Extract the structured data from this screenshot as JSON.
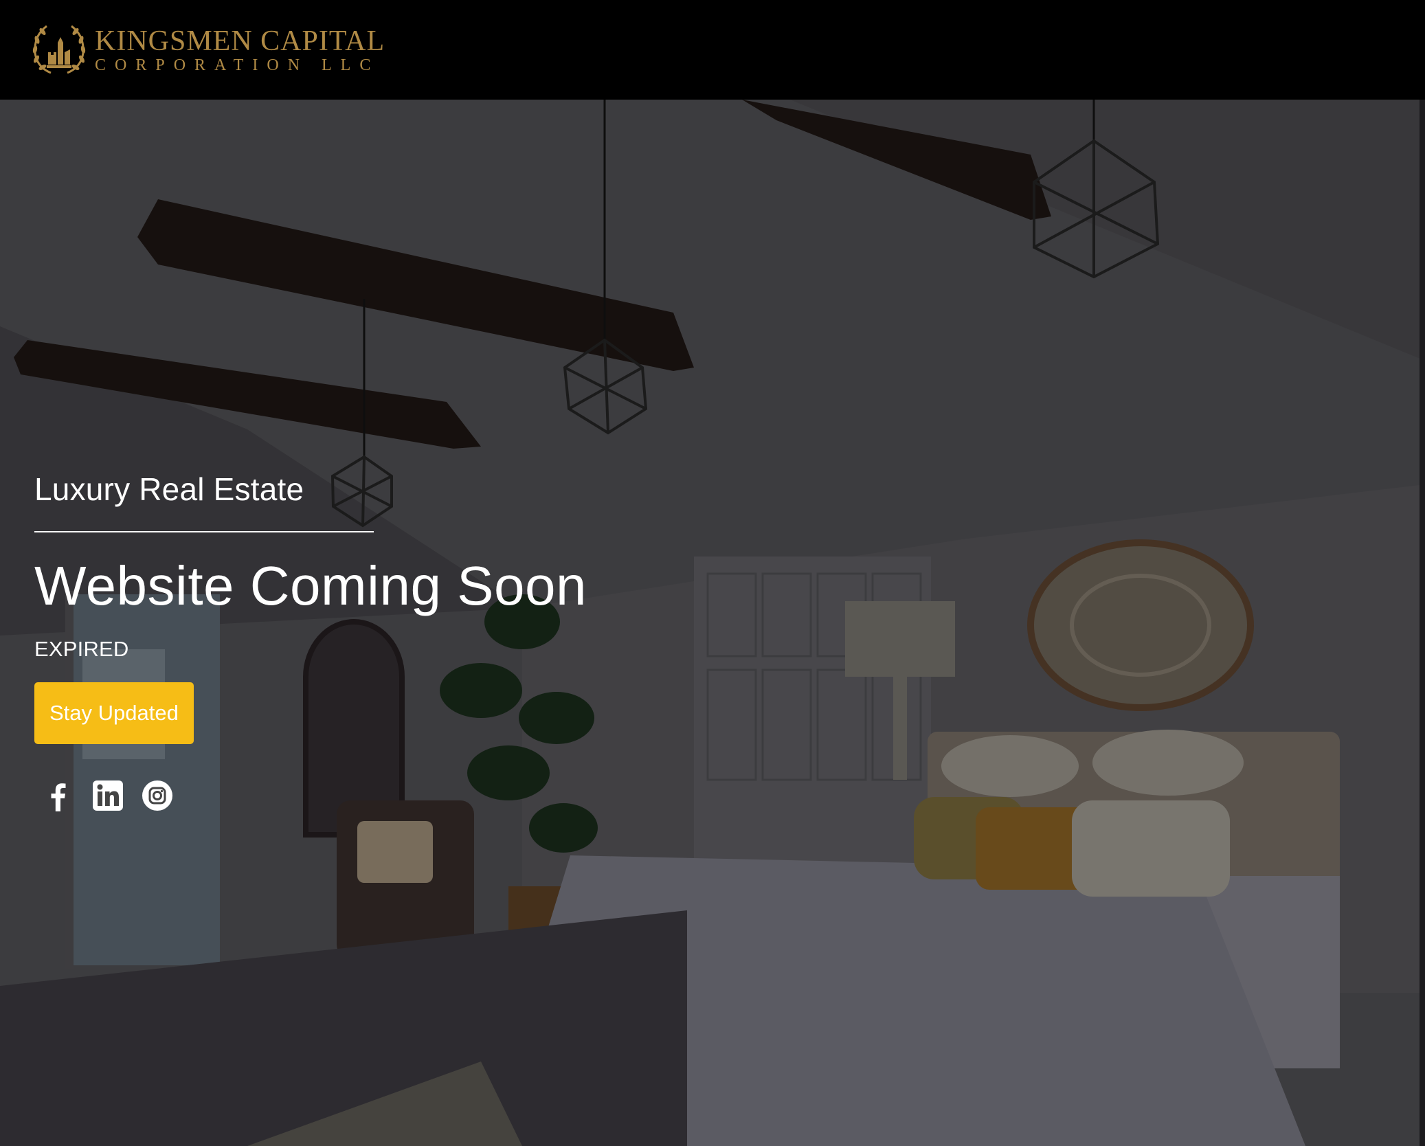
{
  "header": {
    "logo_line1": "KINGSMEN CAPITAL",
    "logo_line2": "CORPORATION LLC"
  },
  "hero": {
    "tagline": "Luxury Real Estate",
    "title": "Website Coming Soon",
    "status": "EXPIRED",
    "cta_label": "Stay Updated"
  },
  "social": [
    {
      "name": "facebook",
      "icon": "facebook-icon"
    },
    {
      "name": "linkedin",
      "icon": "linkedin-icon"
    },
    {
      "name": "instagram",
      "icon": "instagram-icon"
    }
  ],
  "colors": {
    "header_bg": "#000000",
    "brand_gold": "#b08a45",
    "cta_bg": "#f6bd16",
    "text": "#ffffff"
  }
}
